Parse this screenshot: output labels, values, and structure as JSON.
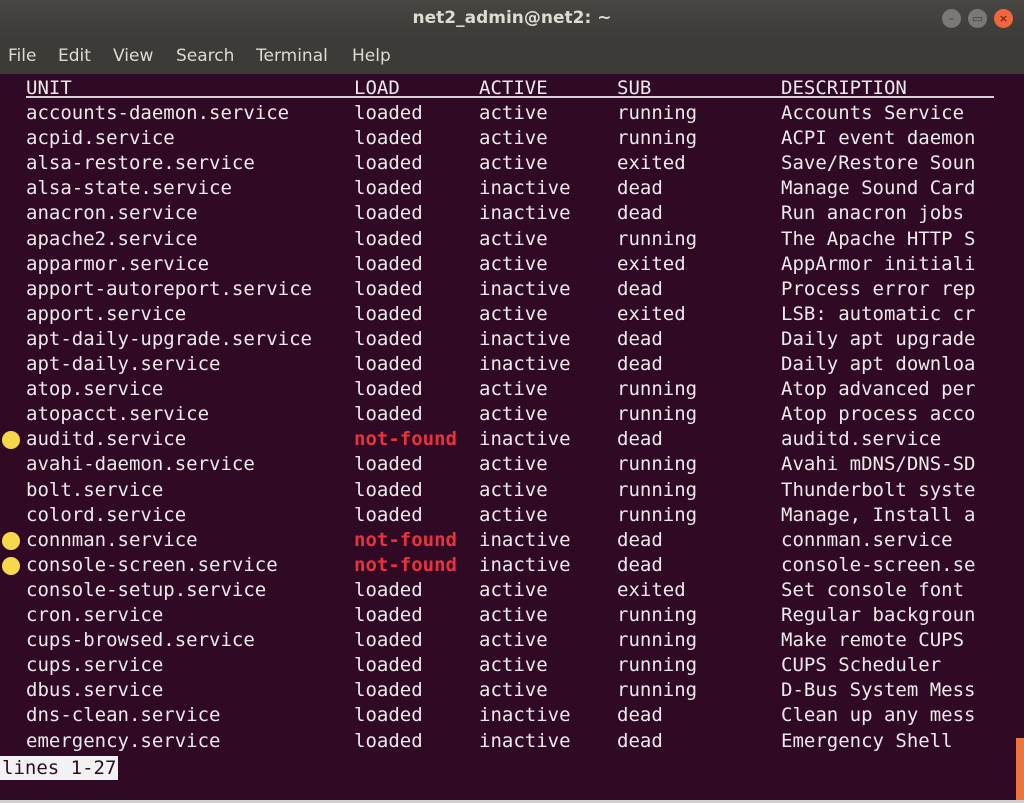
{
  "window": {
    "title": "net2_admin@net2: ~",
    "controls": {
      "minimize": "–",
      "maximize": "▭",
      "close": "×"
    }
  },
  "menubar": [
    "File",
    "Edit",
    "View",
    "Search",
    "Terminal",
    "Help"
  ],
  "table": {
    "headers": {
      "unit": "UNIT",
      "load": "LOAD",
      "active": "ACTIVE",
      "sub": "SUB",
      "description": "DESCRIPTION"
    },
    "rows": [
      {
        "unit": "accounts-daemon.service",
        "load": "loaded",
        "active": "active",
        "sub": "running",
        "description": "Accounts Service",
        "highlight": false
      },
      {
        "unit": "acpid.service",
        "load": "loaded",
        "active": "active",
        "sub": "running",
        "description": "ACPI event daemon",
        "highlight": false
      },
      {
        "unit": "alsa-restore.service",
        "load": "loaded",
        "active": "active",
        "sub": "exited",
        "description": "Save/Restore Soun",
        "highlight": false
      },
      {
        "unit": "alsa-state.service",
        "load": "loaded",
        "active": "inactive",
        "sub": "dead",
        "description": "Manage Sound Card",
        "highlight": false
      },
      {
        "unit": "anacron.service",
        "load": "loaded",
        "active": "inactive",
        "sub": "dead",
        "description": "Run anacron jobs",
        "highlight": false
      },
      {
        "unit": "apache2.service",
        "load": "loaded",
        "active": "active",
        "sub": "running",
        "description": "The Apache HTTP S",
        "highlight": false
      },
      {
        "unit": "apparmor.service",
        "load": "loaded",
        "active": "active",
        "sub": "exited",
        "description": "AppArmor initiali",
        "highlight": false
      },
      {
        "unit": "apport-autoreport.service",
        "load": "loaded",
        "active": "inactive",
        "sub": "dead",
        "description": "Process error rep",
        "highlight": false
      },
      {
        "unit": "apport.service",
        "load": "loaded",
        "active": "active",
        "sub": "exited",
        "description": "LSB: automatic cr",
        "highlight": false
      },
      {
        "unit": "apt-daily-upgrade.service",
        "load": "loaded",
        "active": "inactive",
        "sub": "dead",
        "description": "Daily apt upgrade",
        "highlight": false
      },
      {
        "unit": "apt-daily.service",
        "load": "loaded",
        "active": "inactive",
        "sub": "dead",
        "description": "Daily apt downloa",
        "highlight": false
      },
      {
        "unit": "atop.service",
        "load": "loaded",
        "active": "active",
        "sub": "running",
        "description": "Atop advanced per",
        "highlight": false
      },
      {
        "unit": "atopacct.service",
        "load": "loaded",
        "active": "active",
        "sub": "running",
        "description": "Atop process acco",
        "highlight": false
      },
      {
        "unit": "auditd.service",
        "load": "not-found",
        "active": "inactive",
        "sub": "dead",
        "description": "auditd.service",
        "highlight": true
      },
      {
        "unit": "avahi-daemon.service",
        "load": "loaded",
        "active": "active",
        "sub": "running",
        "description": "Avahi mDNS/DNS-SD",
        "highlight": false
      },
      {
        "unit": "bolt.service",
        "load": "loaded",
        "active": "active",
        "sub": "running",
        "description": "Thunderbolt syste",
        "highlight": false
      },
      {
        "unit": "colord.service",
        "load": "loaded",
        "active": "active",
        "sub": "running",
        "description": "Manage, Install a",
        "highlight": false
      },
      {
        "unit": "connman.service",
        "load": "not-found",
        "active": "inactive",
        "sub": "dead",
        "description": "connman.service",
        "highlight": true
      },
      {
        "unit": "console-screen.service",
        "load": "not-found",
        "active": "inactive",
        "sub": "dead",
        "description": "console-screen.se",
        "highlight": true
      },
      {
        "unit": "console-setup.service",
        "load": "loaded",
        "active": "active",
        "sub": "exited",
        "description": "Set console font",
        "highlight": false
      },
      {
        "unit": "cron.service",
        "load": "loaded",
        "active": "active",
        "sub": "running",
        "description": "Regular backgroun",
        "highlight": false
      },
      {
        "unit": "cups-browsed.service",
        "load": "loaded",
        "active": "active",
        "sub": "running",
        "description": "Make remote CUPS",
        "highlight": false
      },
      {
        "unit": "cups.service",
        "load": "loaded",
        "active": "active",
        "sub": "running",
        "description": "CUPS Scheduler",
        "highlight": false
      },
      {
        "unit": "dbus.service",
        "load": "loaded",
        "active": "active",
        "sub": "running",
        "description": "D-Bus System Mess",
        "highlight": false
      },
      {
        "unit": "dns-clean.service",
        "load": "loaded",
        "active": "inactive",
        "sub": "dead",
        "description": "Clean up any mess",
        "highlight": false
      },
      {
        "unit": "emergency.service",
        "load": "loaded",
        "active": "inactive",
        "sub": "dead",
        "description": "Emergency Shell",
        "highlight": false
      }
    ]
  },
  "pager_status": "lines 1-27",
  "colors": {
    "terminal_bg": "#300a24",
    "not_found": "#e8323c",
    "marker": "#f5d94a",
    "close_button": "#f0663d",
    "scrollbar": "#e9763d"
  }
}
